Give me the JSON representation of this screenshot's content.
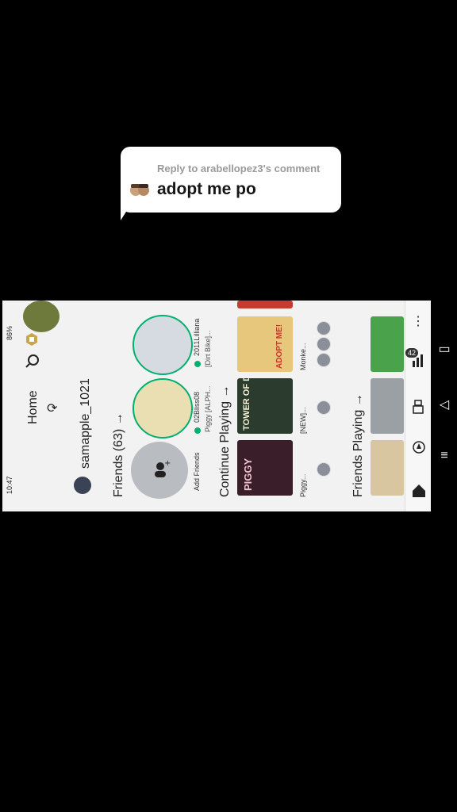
{
  "reply": {
    "header": "Reply to arabellopez3's comment",
    "text": "adopt me po"
  },
  "status_bar": {
    "time": "10:47",
    "battery": "86%"
  },
  "home": {
    "title": "Home",
    "username": "samapple_1021",
    "friends_header": "Friends (63) →",
    "add_friends_label": "Add Friends",
    "friends": [
      {
        "name": "02Bliss08",
        "status": "Piggy [ALPH..."
      },
      {
        "name": "2011Lilliana",
        "status": "[Dirt Bike]..."
      }
    ],
    "continue_header": "Continue Playing →",
    "continue_games": [
      {
        "title": "Piggy...",
        "art": "PIGGY"
      },
      {
        "title": "[NEW]...",
        "art": "TOWER OF DREAD"
      },
      {
        "title": "Monke...",
        "art": "ADOPT ME!"
      }
    ],
    "friends_playing_header": "Friends Playing →",
    "nav_badge": "42"
  },
  "colors": {
    "accent_green": "#00b06f",
    "bubble_bg": "#ffffff",
    "page_bg": "#000000"
  }
}
